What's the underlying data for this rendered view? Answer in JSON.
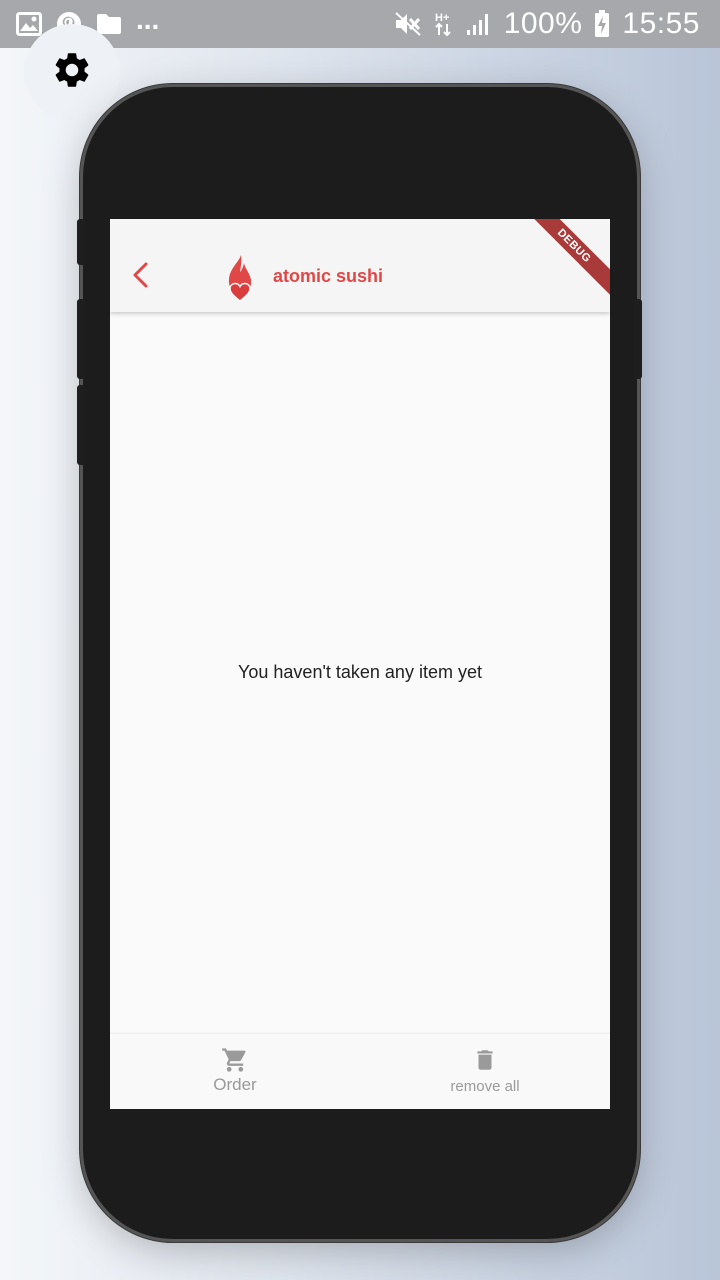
{
  "status_bar": {
    "overflow": "...",
    "battery": "100%",
    "time": "15:55",
    "left_icons": [
      "image-icon",
      "pinterest-icon",
      "folder-icon"
    ],
    "right_icons": [
      "mute-icon",
      "network-hplus-icon",
      "signal-icon",
      "battery-charging-icon"
    ]
  },
  "settings_fab": {
    "icon": "gear-icon"
  },
  "appbar": {
    "back_icon": "chevron-left-icon",
    "logo_icon": "flame-heart-icon",
    "title": "atomic sushi",
    "debug_banner": "DEBUG"
  },
  "main": {
    "empty_message": "You haven't taken any item yet"
  },
  "bottom_bar": {
    "order_label": "Order",
    "order_icon": "cart-icon",
    "remove_label": "remove all",
    "remove_icon": "trash-icon"
  },
  "colors": {
    "accent": "#e04848",
    "debug_ribbon": "#a83a3a",
    "muted": "#9a9a9a",
    "phone_body": "#1c1c1c",
    "status_bar": "#a6a8ab"
  }
}
